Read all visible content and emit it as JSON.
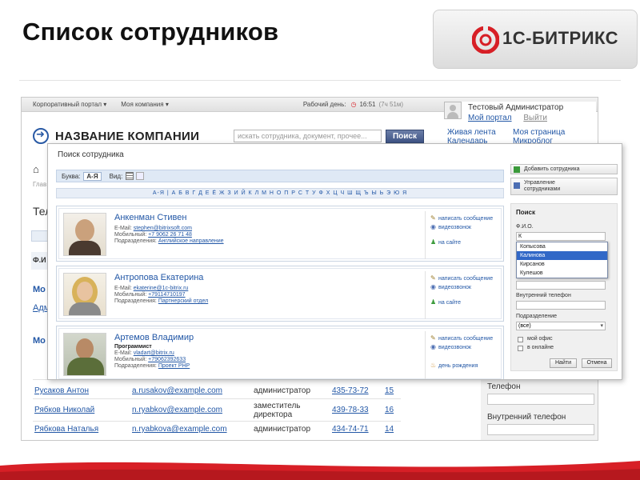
{
  "slide": {
    "title": "Список сотрудников",
    "logo_prefix": "1С-",
    "logo_text": "БИТРИКС"
  },
  "portal": {
    "topbar": {
      "portal_menu": "Корпоративный портал ▾",
      "company_menu": "Моя компания ▾",
      "workday": "Рабочий день:",
      "time": "16:51",
      "elapsed": "(7ч 51м)"
    },
    "user": {
      "name": "Тестовый Администратор",
      "my_portal": "Мой портал",
      "logout": "Выйти"
    },
    "quick_links": [
      "Живая лента",
      "Моя страница",
      "Календарь",
      "Микроблог"
    ],
    "company_name": "НАЗВАНИЕ КОМПАНИИ",
    "search_placeholder": "искать сотрудника, документ, прочее...",
    "search_button": "Поиск",
    "left_fragments": {
      "breadcrumb": "Глав",
      "heading": "Тел",
      "fio": "Ф.И",
      "link1": "Мо",
      "link2": "Адм",
      "link3": "Мо"
    },
    "employees": [
      {
        "name": "Русаков Антон",
        "email": "a.rusakov@example.com",
        "position": "администратор",
        "phone": "435-73-72",
        "ext": "15"
      },
      {
        "name": "Рябков Николай",
        "email": "n.ryabkov@example.com",
        "position": "заместитель директора",
        "phone": "439-78-33",
        "ext": "16"
      },
      {
        "name": "Рябкова Наталья",
        "email": "n.ryabkova@example.com",
        "position": "администратор",
        "phone": "434-74-71",
        "ext": "14"
      }
    ],
    "right_panel": {
      "phone_label": "Телефон",
      "ext_label": "Внутренний телефон"
    }
  },
  "modal": {
    "title": "Поиск сотрудника",
    "letter_label": "Буква:",
    "letter_range": "А-Я",
    "view_label": "Вид:",
    "alphabet": "А-Я | А Б В Г Д Е Ё Ж З И Й К Л М Н О П Р С Т У Ф Х Ц Ч Ш Щ Ъ Ы Ь Э Ю Я",
    "labels": {
      "email": "E-Mail:",
      "mobile": "Мобильный:",
      "department": "Подразделения:"
    },
    "employees": [
      {
        "name": "Анкенман Стивен",
        "position": "",
        "email": "stephen@bitrixsoft.com",
        "mobile": "+7 9062 26 71 48",
        "department": "Английское направление",
        "actions": [
          "написать сообщение",
          "видеозвонок",
          "на сайте"
        ]
      },
      {
        "name": "Антропова Екатерина",
        "position": "",
        "email": "ekaterine@1c-bitrix.ru",
        "mobile": "+79114710197",
        "department": "Партнерский отдел",
        "actions": [
          "написать сообщение",
          "видеозвонок",
          "на сайте"
        ]
      },
      {
        "name": "Артемов Владимир",
        "position": "Программист",
        "email": "vladart@bitrix.ru",
        "mobile": "+79062392633",
        "department": "Проект PHP",
        "actions": [
          "написать сообщение",
          "видеозвонок",
          "день рождения"
        ]
      }
    ],
    "add_button": "Добавить сотрудника",
    "manage_button_line1": "Управление",
    "manage_button_line2": "сотрудниками",
    "search_panel": {
      "title": "Поиск",
      "fio_label": "Ф.И.О.",
      "fio_value": "К",
      "suggestions": [
        "Копысова",
        "Калинова",
        "Кирсанов",
        "Кулешов"
      ],
      "selected_index": 1,
      "ext_label": "Внутренний телефон",
      "dept_label": "Подразделение",
      "dept_value": "(все)",
      "check_my_office": "мой офис",
      "check_online": "в онлайне",
      "find_button": "Найти",
      "cancel_button": "Отмена"
    }
  },
  "colors": {
    "accent_red": "#d71f26",
    "link_blue": "#2257a6"
  }
}
